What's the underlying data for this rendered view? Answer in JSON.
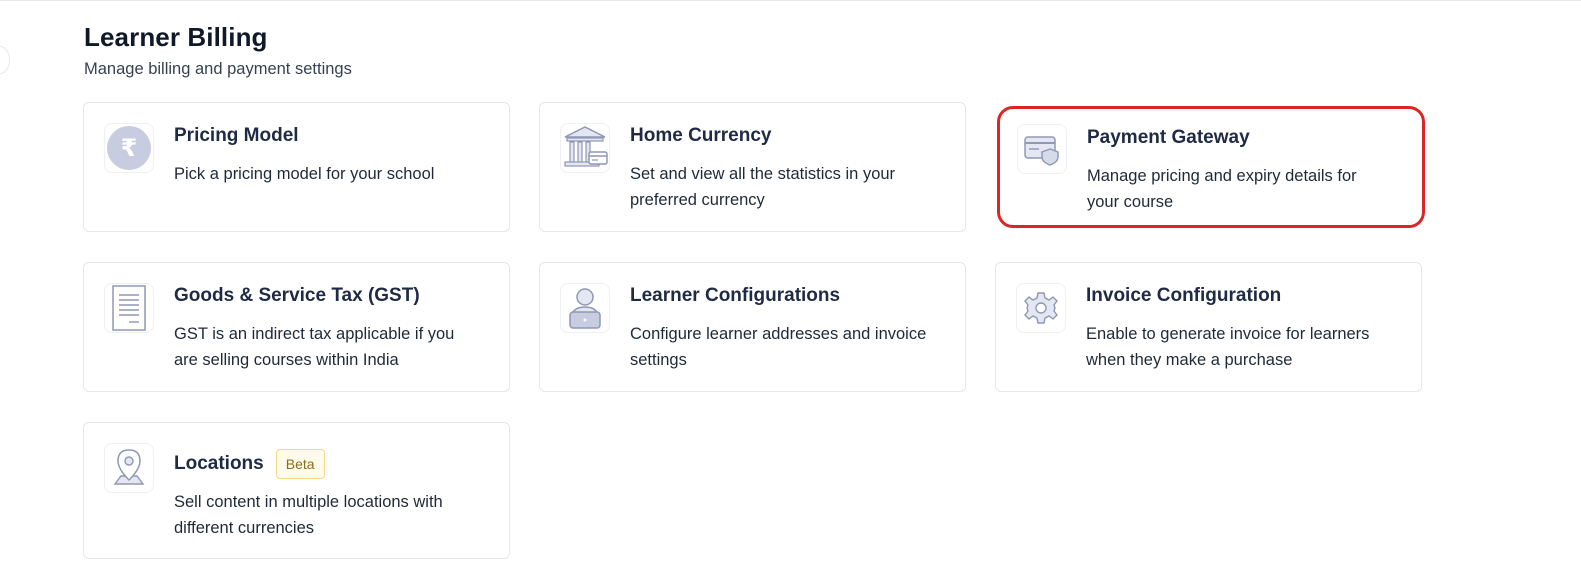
{
  "header": {
    "title": "Learner Billing",
    "subtitle": "Manage billing and payment settings"
  },
  "cards": [
    {
      "title": "Pricing Model",
      "description": "Pick a pricing model for your school",
      "icon": "rupee-icon"
    },
    {
      "title": "Home Currency",
      "description": "Set and view all the statistics in your preferred currency",
      "icon": "bank-icon"
    },
    {
      "title": "Payment Gateway",
      "description": "Manage pricing and expiry details for your course",
      "icon": "credit-card-shield-icon"
    },
    {
      "title": "Goods & Service Tax (GST)",
      "description": "GST is an indirect tax applicable if you are selling courses within India",
      "icon": "document-icon"
    },
    {
      "title": "Learner Configurations",
      "description": "Configure learner addresses and invoice settings",
      "icon": "user-laptop-icon"
    },
    {
      "title": "Invoice Configuration",
      "description": "Enable to generate invoice for learners when they make a purchase",
      "icon": "gear-icon"
    },
    {
      "title": "Locations",
      "description": "Sell content in multiple locations with different currencies",
      "icon": "map-pin-icon",
      "badge": "Beta"
    }
  ],
  "colors": {
    "highlight": "#dc2626",
    "icon_stroke": "#8f97b3",
    "icon_fill": "#c7cce0",
    "badge_bg": "#fffbea",
    "badge_border": "#f5d88a"
  }
}
